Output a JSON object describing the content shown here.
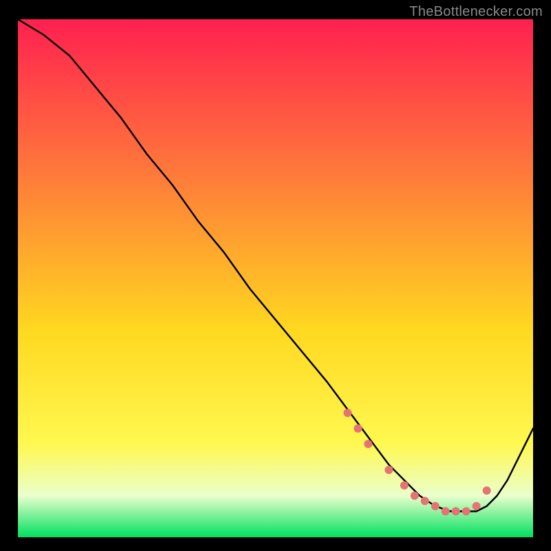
{
  "attribution": "TheBottlenecker.com",
  "colors": {
    "gradient_top": "#ff2050",
    "gradient_upper": "#ff7a3a",
    "gradient_mid": "#ffd820",
    "gradient_lower": "#fff850",
    "gradient_band": "#eaffcc",
    "gradient_bottom": "#00e060",
    "curve": "#000000",
    "marker": "#e57373"
  },
  "chart_data": {
    "type": "line",
    "title": "",
    "xlabel": "",
    "ylabel": "",
    "xlim": [
      0,
      100
    ],
    "ylim": [
      0,
      100
    ],
    "series": [
      {
        "name": "bottleneck-curve",
        "x": [
          0,
          5,
          10,
          15,
          20,
          25,
          30,
          35,
          40,
          45,
          50,
          55,
          60,
          63,
          66,
          69,
          72,
          75,
          78,
          81,
          84,
          87,
          89,
          91,
          93,
          95,
          97,
          100
        ],
        "y": [
          100,
          97,
          93,
          87,
          81,
          74,
          68,
          61,
          55,
          48,
          42,
          36,
          30,
          26,
          22,
          18,
          14,
          11,
          8,
          6,
          5,
          5,
          5,
          6,
          8,
          11,
          15,
          21
        ]
      }
    ],
    "markers": {
      "name": "highlighted-points",
      "x": [
        64,
        66,
        68,
        72,
        75,
        77,
        79,
        81,
        83,
        85,
        87,
        89,
        91
      ],
      "y": [
        24,
        21,
        18,
        13,
        10,
        8,
        7,
        6,
        5,
        5,
        5,
        6,
        9
      ]
    }
  }
}
